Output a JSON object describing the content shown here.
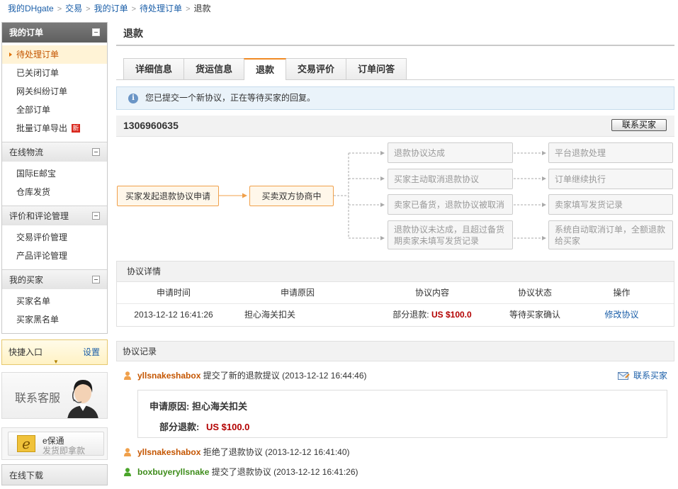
{
  "breadcrumb": {
    "items": [
      "我的DHgate",
      "交易",
      "我的订单",
      "待处理订单",
      "退款"
    ],
    "separator": ">"
  },
  "sidebar": {
    "sections": [
      {
        "title": "我的订单",
        "items": [
          "待处理订单",
          "已关闭订单",
          "网关纠纷订单",
          "全部订单",
          "批量订单导出"
        ],
        "new_badge": "新"
      },
      {
        "title": "在线物流",
        "items": [
          "国际E邮宝",
          "仓库发货"
        ]
      },
      {
        "title": "评价和评论管理",
        "items": [
          "交易评价管理",
          "产品评论管理"
        ]
      },
      {
        "title": "我的买家",
        "items": [
          "买家名单",
          "买家黑名单"
        ]
      }
    ],
    "quick_entry": {
      "title": "快捷入口",
      "settings": "设置"
    },
    "customer_service": "联系客服",
    "ebao": {
      "line1": "e保通",
      "line2": "发货即拿款",
      "logo": "e"
    },
    "download": "在线下载"
  },
  "main": {
    "title": "退款",
    "tabs": [
      "详细信息",
      "货运信息",
      "退款",
      "交易评价",
      "订单问答"
    ],
    "active_tab": 2,
    "notice": "您已提交一个新协议，正在等待买家的回复。",
    "order_number": "1306960635",
    "contact_buyer": "联系买家",
    "flow": {
      "start": "买家发起退款协议申请",
      "middle": "买卖双方协商中",
      "branches": [
        {
          "condition": "退款协议达成",
          "result": "平台退款处理"
        },
        {
          "condition": "买家主动取消退款协议",
          "result": "订单继续执行"
        },
        {
          "condition": "卖家已备货，退款协议被取消",
          "result": "卖家填写发货记录"
        },
        {
          "condition_line1": "退款协议未达成，且超过备货",
          "condition_line2": "期卖家未填写发货记录",
          "result_line1": "系统自动取消订单，全额退款",
          "result_line2": "给买家"
        }
      ]
    },
    "details": {
      "title": "协议详情",
      "headers": [
        "申请时间",
        "申请原因",
        "协议内容",
        "协议状态",
        "操作"
      ],
      "row": {
        "time": "2013-12-12 16:41:26",
        "reason": "担心海关扣关",
        "content_label": "部分退款:",
        "content_price": "US $100.0",
        "status": "等待买家确认",
        "action": "修改协议"
      }
    },
    "records": {
      "title": "协议记录",
      "contact": "联系买家",
      "items": [
        {
          "user": "yllsnakeshabox",
          "role": "seller",
          "action": "提交了新的退款提议",
          "time": "(2013-12-12 16:44:46)"
        },
        {
          "user": "yllsnakeshabox",
          "role": "seller",
          "action": "拒绝了退款协议",
          "time": "(2013-12-12 16:41:40)"
        },
        {
          "user": "boxbuyeryllsnake",
          "role": "buyer",
          "action": "提交了退款协议",
          "time": "(2013-12-12 16:41:26)"
        }
      ],
      "detail": {
        "reason_label": "申请原因:",
        "reason": "担心海关扣关",
        "refund_label": "部分退款:",
        "refund": "US $100.0"
      }
    }
  },
  "colors": {
    "accent": "#f08a24",
    "link": "#1a5ea8",
    "price": "#b30000",
    "seller": "#c45500",
    "buyer": "#3d8c1a"
  }
}
